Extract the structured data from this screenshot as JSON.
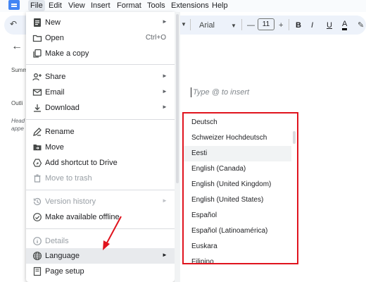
{
  "menubar": {
    "items": [
      "File",
      "Edit",
      "View",
      "Insert",
      "Format",
      "Tools",
      "Extensions",
      "Help"
    ]
  },
  "toolbar": {
    "font_name": "Arial",
    "font_size": "11",
    "minus": "—",
    "plus": "+",
    "bold": "B",
    "italic": "I",
    "underline": "U",
    "text_color": "A"
  },
  "left_panel": {
    "summary_label": "Summ",
    "outline_label": "Outli",
    "outline_hint_1": "Head",
    "outline_hint_2": "appe"
  },
  "document": {
    "placeholder": "Type @ to insert"
  },
  "file_menu": {
    "items": [
      {
        "label": "New",
        "icon": "document-icon",
        "has_submenu": true
      },
      {
        "label": "Open",
        "icon": "folder-icon",
        "shortcut": "Ctrl+O"
      },
      {
        "label": "Make a copy",
        "icon": "copy-icon"
      },
      {
        "label": "Share",
        "icon": "person-add-icon",
        "has_submenu": true
      },
      {
        "label": "Email",
        "icon": "envelope-icon",
        "has_submenu": true
      },
      {
        "label": "Download",
        "icon": "download-icon",
        "has_submenu": true
      },
      {
        "label": "Rename",
        "icon": "pencil-icon"
      },
      {
        "label": "Move",
        "icon": "move-folder-icon"
      },
      {
        "label": "Add shortcut to Drive",
        "icon": "drive-shortcut-icon"
      },
      {
        "label": "Move to trash",
        "icon": "trash-icon",
        "disabled": true
      },
      {
        "label": "Version history",
        "icon": "history-icon",
        "disabled": true,
        "has_submenu": true
      },
      {
        "label": "Make available offline",
        "icon": "offline-icon"
      },
      {
        "label": "Details",
        "icon": "info-icon",
        "disabled": true
      },
      {
        "label": "Language",
        "icon": "globe-icon",
        "has_submenu": true,
        "highlighted": true
      },
      {
        "label": "Page setup",
        "icon": "page-setup-icon"
      }
    ],
    "submenu_arrow": "►"
  },
  "language_menu": {
    "items": [
      "Deutsch",
      "Schweizer Hochdeutsch",
      "Eesti",
      "English (Canada)",
      "English (United Kingdom)",
      "English (United States)",
      "Español",
      "Español (Latinoamérica)",
      "Euskara",
      "Filipino"
    ],
    "highlighted_index": 2
  },
  "colors": {
    "highlight_box": "#e0141e",
    "annotation_arrow": "#e0141e",
    "app_blue": "#4285f4"
  }
}
